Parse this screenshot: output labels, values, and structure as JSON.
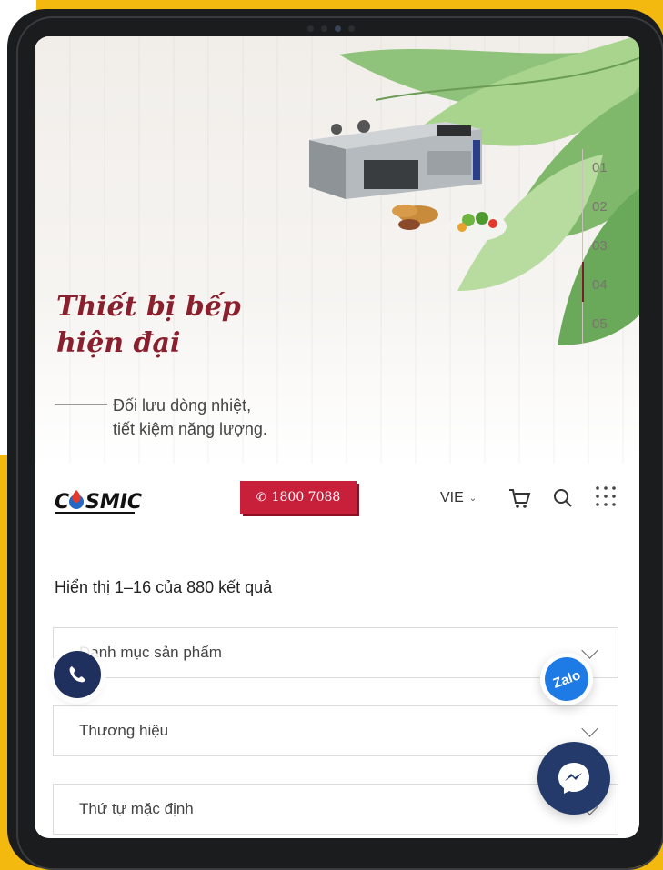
{
  "hero": {
    "title_line1": "Thiết bị bếp",
    "title_line2": "hiện đại",
    "subtitle_line1": "Đối lưu dòng nhiệt,",
    "subtitle_line2": "tiết kiệm năng lượng.",
    "slides": [
      "01",
      "02",
      "03",
      "04",
      "05"
    ],
    "active_slide": "04"
  },
  "header": {
    "logo_text": "COSMIC",
    "phone_label": "1800 7088",
    "language": "VIE",
    "icons": [
      "cart-icon",
      "search-icon",
      "grid-menu-icon"
    ]
  },
  "results": {
    "summary": "Hiển thị 1–16 của 880 kết quả"
  },
  "filters": [
    {
      "label": "Danh mục sản phẩm"
    },
    {
      "label": "Thương hiệu"
    },
    {
      "label": "Thứ tự mặc định"
    }
  ],
  "floating": {
    "zalo_label": "Zalo",
    "icons": [
      "phone-icon",
      "zalo-icon",
      "messenger-icon"
    ]
  },
  "colors": {
    "accent_red": "#c81f3b",
    "title_red": "#8a1f2e",
    "navy": "#1f2f5e",
    "page_bg_yellow": "#f4b90f"
  }
}
